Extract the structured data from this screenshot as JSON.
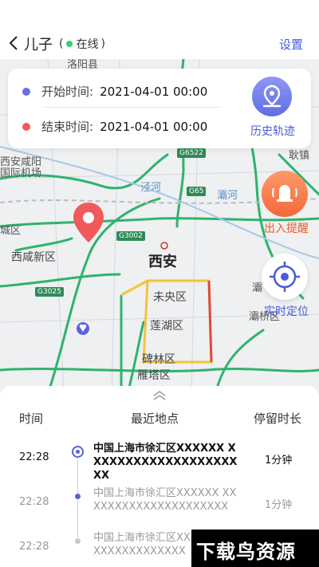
{
  "header": {
    "title": "儿子",
    "status_open": "(",
    "status_text": "在线",
    "status_close": ")",
    "settings_label": "设置"
  },
  "time_card": {
    "start_label": "开始时间:",
    "start_value": "2021-04-01 00:00",
    "end_label": "结束时间:",
    "end_value": "2021-04-01 00:00",
    "start_color": "#6b6fe0",
    "end_color": "#f25a5a",
    "history_label": "历史轨迹"
  },
  "map": {
    "labels": {
      "top_partial": "洛阳县",
      "airport_1": "西安咸阳",
      "airport_2": "国际机场",
      "left_partial": "城区",
      "xixian": "西咸新区",
      "xian": "西安",
      "weiyang": "未央区",
      "lianhu": "莲湖区",
      "beilin": "碑林区",
      "yanta": "雁塔区",
      "river_1": "泾河",
      "river_2": "灞河",
      "right_top": "耿镇",
      "right_mid": "灞",
      "right_low": "灞桥区"
    },
    "road_badges": {
      "g3002": "G3002",
      "g65": "G65",
      "g6522": "G6522",
      "g3025": "G3025"
    },
    "alarm_label": "出入提醒",
    "locate_label": "实时定位"
  },
  "panel": {
    "col_time": "时间",
    "col_place": "最近地点",
    "col_stay": "停留时长",
    "rows": [
      {
        "time": "22:28",
        "address": "中国上海市徐汇区XXXXXX XXXXXXXXXXXXXXXXXXXXX",
        "duration": "1分钟"
      },
      {
        "time": "22:28",
        "address": "中国上海市徐汇区XXXXXX XXXXXXXXXXXXXXXXXXXXX",
        "duration": "1分钟"
      },
      {
        "time": "22:28",
        "address": "中国上海市徐汇区XXXXXX XXXXXXXXXXXXXXX",
        "duration": ""
      }
    ]
  },
  "watermark": {
    "text": "下载鸟资源"
  }
}
